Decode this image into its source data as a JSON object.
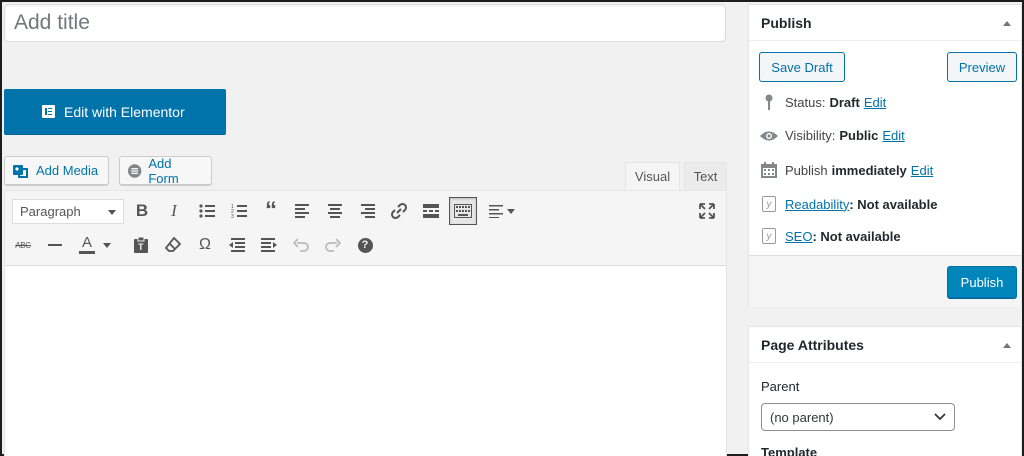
{
  "title": {
    "placeholder": "Add title"
  },
  "elementor": {
    "label": "Edit with Elementor"
  },
  "media_buttons": {
    "add_media": "Add Media",
    "add_form": "Add Form"
  },
  "editor_tabs": {
    "visual": "Visual",
    "text": "Text"
  },
  "toolbar": {
    "format_select": "Paragraph",
    "row1_icons": [
      "bold-icon",
      "italic-icon",
      "bullet-list-icon",
      "numbered-list-icon",
      "blockquote-icon",
      "align-left-icon",
      "align-center-icon",
      "align-right-icon",
      "link-icon",
      "read-more-icon",
      "toolbar-toggle-icon",
      "align-dropdown-icon",
      "fullscreen-icon"
    ],
    "row2_icons": [
      "strikethrough-icon",
      "horizontal-line-icon",
      "text-color-icon",
      "paste-text-icon",
      "clear-formatting-icon",
      "special-character-icon",
      "outdent-icon",
      "indent-icon",
      "undo-icon",
      "redo-icon",
      "help-icon"
    ],
    "strike_glyph": "ABC",
    "text_color_glyph": "A",
    "omega_glyph": "Ω",
    "help_glyph": "?"
  },
  "publish_box": {
    "title": "Publish",
    "save_draft": "Save Draft",
    "preview": "Preview",
    "status_label": "Status:",
    "status_value": "Draft",
    "visibility_label": "Visibility:",
    "visibility_value": "Public",
    "publish_label": "Publish",
    "publish_value": "immediately",
    "edit": "Edit",
    "readability_link": "Readability",
    "readability_value": ": Not available",
    "seo_link": "SEO",
    "seo_value": ": Not available",
    "publish_button": "Publish"
  },
  "page_attributes": {
    "title": "Page Attributes",
    "parent_label": "Parent",
    "parent_value": "(no parent)",
    "template_label": "Template"
  },
  "colors": {
    "accent": "#0073aa",
    "primary_button": "#0085ba"
  }
}
